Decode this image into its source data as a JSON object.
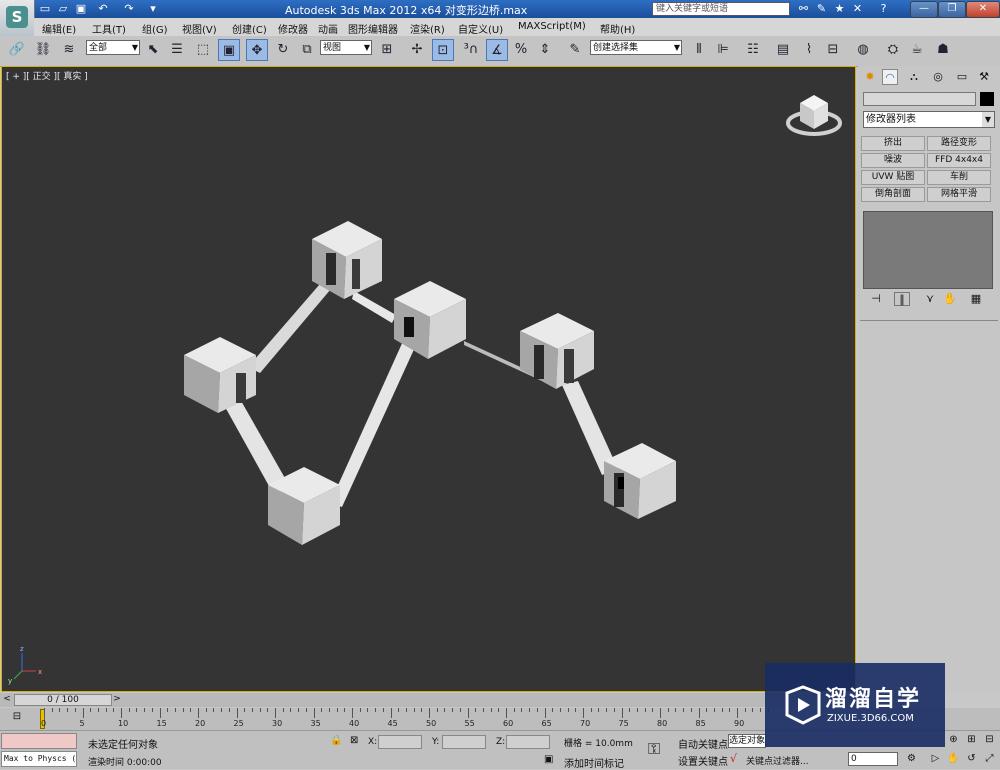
{
  "titlebar": {
    "title": "Autodesk 3ds Max  2012 x64      对变形边桥.max",
    "search_placeholder": "键入关键字或短语"
  },
  "menu": [
    "编辑(E)",
    "工具(T)",
    "组(G)",
    "视图(V)",
    "创建(C)",
    "修改器",
    "动画",
    "图形编辑器",
    "渲染(R)",
    "自定义(U)",
    "MAXScript(M)",
    "帮助(H)"
  ],
  "toolbar": {
    "selection_filter": "全部",
    "ref_coord": "视图",
    "named_selection": "创建选择集"
  },
  "viewport": {
    "label": "[ + ][ 正交 ][ 真实 ]",
    "gizmo_axes": {
      "x": "x",
      "y": "y",
      "z": "z"
    }
  },
  "command_panel": {
    "modifier_list": "修改器列表",
    "buttons": [
      [
        "挤出",
        "路径变形"
      ],
      [
        "噪波",
        "FFD 4x4x4"
      ],
      [
        "UVW 贴图",
        "车削"
      ],
      [
        "倒角剖面",
        "网格平滑"
      ]
    ]
  },
  "timeslider": {
    "position_label": "0 / 100",
    "current_frame": 0,
    "total_frames": 100
  },
  "trackbar": {
    "ticks": [
      "0",
      "5",
      "10",
      "15",
      "20",
      "25",
      "30",
      "35",
      "40",
      "45",
      "50",
      "55",
      "60",
      "65",
      "70",
      "75",
      "80",
      "85",
      "90"
    ]
  },
  "status": {
    "script_mini": "Max to Physcs (",
    "selection_status": "未选定任何对象",
    "render_time": "渲染时间  0:00:00",
    "x_label": "X:",
    "y_label": "Y:",
    "z_label": "Z:",
    "grid": "栅格 = 10.0mm",
    "add_time_tag": "添加时间标记",
    "auto_key": "自动关键点",
    "set_key": "设置关键点",
    "selected": "选定对象",
    "key_filters": "关键点过滤器...",
    "frame_value": "0"
  },
  "watermark": {
    "title": "溜溜自学",
    "url": "ZIXUE.3D66.COM"
  },
  "colors": {
    "viewport_bg": "#343434",
    "viewport_border": "#d9b000",
    "titlebar": "#2e6fc4",
    "watermark_bg": "#182c64"
  }
}
